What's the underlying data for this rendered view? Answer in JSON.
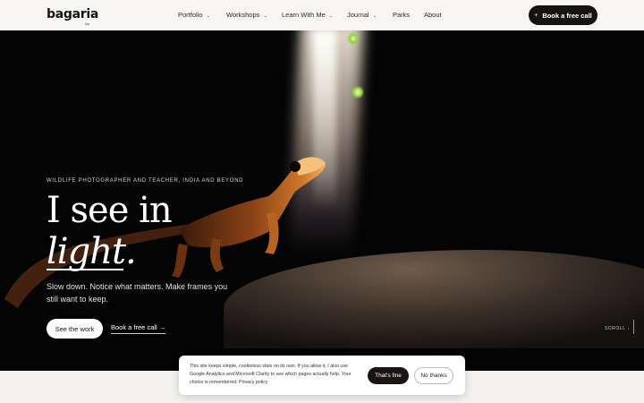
{
  "brand": {
    "name": "bagaria",
    "sub": "ink"
  },
  "nav": {
    "items": [
      {
        "label": "Portfolio",
        "has_menu": true
      },
      {
        "label": "Workshops",
        "has_menu": true
      },
      {
        "label": "Learn With Me",
        "has_menu": true
      },
      {
        "label": "Journal",
        "has_menu": true
      },
      {
        "label": "Parks",
        "has_menu": false
      },
      {
        "label": "About",
        "has_menu": false
      }
    ],
    "cta": {
      "icon": "+",
      "label": "Book a free call"
    }
  },
  "hero": {
    "tagline": "WILDLIFE PHOTOGRAPHER AND TEACHER, INDIA AND BEYOND",
    "headline_line1": "I see in",
    "headline_line2": "light.",
    "subtext": "Slow down. Notice what matters. Make frames you still want to keep.",
    "primary_button": "See the work",
    "secondary_link": "Book a free call",
    "secondary_arrow": "→",
    "scroll_label": "SCROLL ↓"
  },
  "cookie": {
    "text": "This site keeps simple, cookieless stats on its own. If you allow it, I also use Google Analytics and Microsoft Clarity to see which pages actually help. Your choice is remembered. Privacy policy",
    "accept_label": "That's fine",
    "decline_label": "No thanks"
  },
  "colors": {
    "dark": "#171311",
    "hero_bg": "#040404",
    "page_bg": "#f4f2ef"
  }
}
